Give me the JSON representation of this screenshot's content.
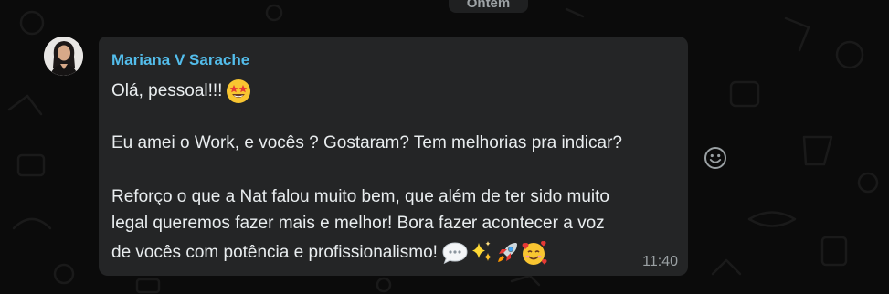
{
  "chat": {
    "date_chip": "Ontem"
  },
  "message": {
    "sender": "Mariana V Sarache",
    "lines": {
      "greeting": "Olá, pessoal!!!",
      "question": "Eu amei o Work, e vocês ? Gostaram? Tem melhorias pra indicar?",
      "body1": "Reforço o que a Nat falou muito bem, que além de ter sido muito",
      "body2": "legal queremos fazer mais e melhor! Bora fazer acontecer a voz",
      "body3": "de vocês com potência e profissionalismo!"
    },
    "emojis": [
      "star-struck",
      "speech-balloon",
      "sparkles",
      "rocket",
      "smiling-face-with-hearts"
    ],
    "time": "11:40"
  },
  "colors": {
    "background": "#0b0b0b",
    "bubble": "#242526",
    "sender_name": "#53bdeb",
    "text": "#e9edef",
    "timestamp": "#9aa0a3"
  },
  "icons": {
    "react": "smiley-icon"
  }
}
